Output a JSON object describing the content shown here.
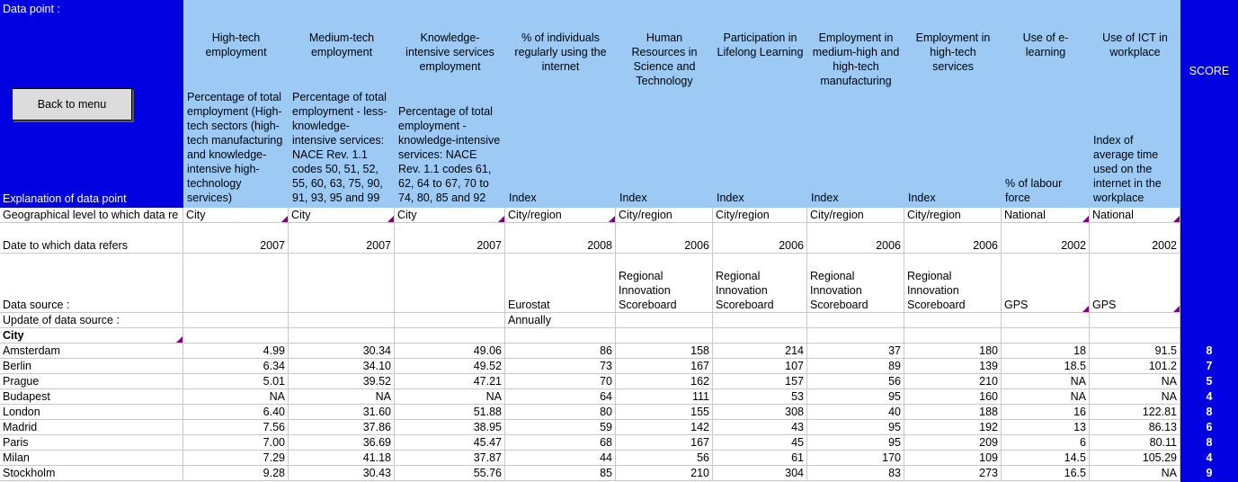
{
  "panel": {
    "data_point_label": "Data point :",
    "back_button": "Back to menu",
    "explanation_label": "Explanation of data point"
  },
  "score_column": {
    "header": "SCORE"
  },
  "row_labels": {
    "geo_level": "Geographical level to which data re",
    "date": "Date to which data refers",
    "data_source": "Data source  :",
    "update": "Update of data source :",
    "city": "City"
  },
  "columns": [
    {
      "title": "High-tech employment",
      "desc": "Percentage of total employment (High-tech sectors (high-tech manufacturing and knowledge-intensive high-technology services)",
      "geo_level": "City",
      "date": "2007",
      "data_source": "",
      "update": ""
    },
    {
      "title": "Medium-tech employment",
      "desc": "Percentage of total employment - less-knowledge-intensive services: NACE Rev. 1.1 codes 50, 51, 52, 55, 60, 63, 75, 90, 91, 93, 95 and 99",
      "geo_level": "City",
      "date": "2007",
      "data_source": "",
      "update": ""
    },
    {
      "title": "Knowledge-intensive services employment",
      "desc": "Percentage of total employment - knowledge-intensive services: NACE Rev. 1.1 codes 61, 62, 64 to 67, 70 to 74, 80, 85 and 92",
      "geo_level": "City",
      "date": "2007",
      "data_source": "",
      "update": ""
    },
    {
      "title": "% of individuals regularly using the internet",
      "desc": "Index",
      "geo_level": "City/region",
      "date": "2008",
      "data_source": "Eurostat",
      "update": "Annually"
    },
    {
      "title": "Human Resources in Science and Technology",
      "desc": "Index",
      "geo_level": "City/region",
      "date": "2006",
      "data_source": "Regional Innovation Scoreboard",
      "update": ""
    },
    {
      "title": "Participation in Lifelong Learning",
      "desc": "Index",
      "geo_level": "City/region",
      "date": "2006",
      "data_source": "Regional Innovation Scoreboard",
      "update": ""
    },
    {
      "title": "Employment in medium-high and high-tech manufacturing",
      "desc": "Index",
      "geo_level": "City/region",
      "date": "2006",
      "data_source": "Regional Innovation Scoreboard",
      "update": ""
    },
    {
      "title": "Employment in high-tech services",
      "desc": "Index",
      "geo_level": "City/region",
      "date": "2006",
      "data_source": "Regional Innovation Scoreboard",
      "update": ""
    },
    {
      "title": "Use of e-learning",
      "desc": "% of labour force",
      "geo_level": "National",
      "date": "2002",
      "data_source": "GPS",
      "update": ""
    },
    {
      "title": "Use of ICT in workplace",
      "desc": "Index of average time used on the internet in the workplace",
      "geo_level": "National",
      "date": "2002",
      "data_source": "GPS",
      "update": ""
    }
  ],
  "rows": [
    {
      "city": "Amsterdam",
      "values": [
        "4.99",
        "30.34",
        "49.06",
        "86",
        "158",
        "214",
        "37",
        "180",
        "18",
        "91.5"
      ],
      "score": "8"
    },
    {
      "city": "Berlin",
      "values": [
        "6.34",
        "34.10",
        "49.52",
        "73",
        "167",
        "107",
        "89",
        "139",
        "18.5",
        "101.2"
      ],
      "score": "7"
    },
    {
      "city": "Prague",
      "values": [
        "5.01",
        "39.52",
        "47.21",
        "70",
        "162",
        "157",
        "56",
        "210",
        "NA",
        "NA"
      ],
      "score": "5"
    },
    {
      "city": "Budapest",
      "values": [
        "NA",
        "NA",
        "NA",
        "64",
        "111",
        "53",
        "95",
        "160",
        "NA",
        "NA"
      ],
      "score": "4"
    },
    {
      "city": "London",
      "values": [
        "6.40",
        "31.60",
        "51.88",
        "80",
        "155",
        "308",
        "40",
        "188",
        "16",
        "122.81"
      ],
      "score": "8"
    },
    {
      "city": "Madrid",
      "values": [
        "7.56",
        "37.86",
        "38.95",
        "59",
        "142",
        "43",
        "95",
        "192",
        "13",
        "86.13"
      ],
      "score": "6"
    },
    {
      "city": "Paris",
      "values": [
        "7.00",
        "36.69",
        "45.47",
        "68",
        "167",
        "45",
        "95",
        "209",
        "6",
        "80.11"
      ],
      "score": "8"
    },
    {
      "city": "Milan",
      "values": [
        "7.29",
        "41.18",
        "37.87",
        "44",
        "56",
        "61",
        "170",
        "109",
        "14.5",
        "105.29"
      ],
      "score": "4"
    },
    {
      "city": "Stockholm",
      "values": [
        "9.28",
        "30.43",
        "55.76",
        "85",
        "210",
        "304",
        "83",
        "273",
        "16.5",
        "NA"
      ],
      "score": "9"
    }
  ],
  "colors": {
    "header_blue": "#0000e0",
    "header_light_blue": "#9ccaf5",
    "grid_line": "#c8c8c8",
    "comment_marker": "#800080"
  }
}
